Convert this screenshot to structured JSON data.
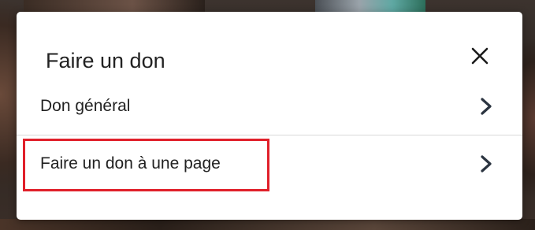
{
  "modal": {
    "title": "Faire un don",
    "close_icon": "close-icon",
    "options": [
      {
        "label": "Don général",
        "icon": "chevron-right-icon"
      },
      {
        "label": "Faire un don à une page",
        "icon": "chevron-right-icon",
        "highlighted": true
      }
    ]
  },
  "colors": {
    "highlight": "#e0202a",
    "text": "#222222",
    "chevron": "#2b3440",
    "divider": "#d9d9d9"
  }
}
